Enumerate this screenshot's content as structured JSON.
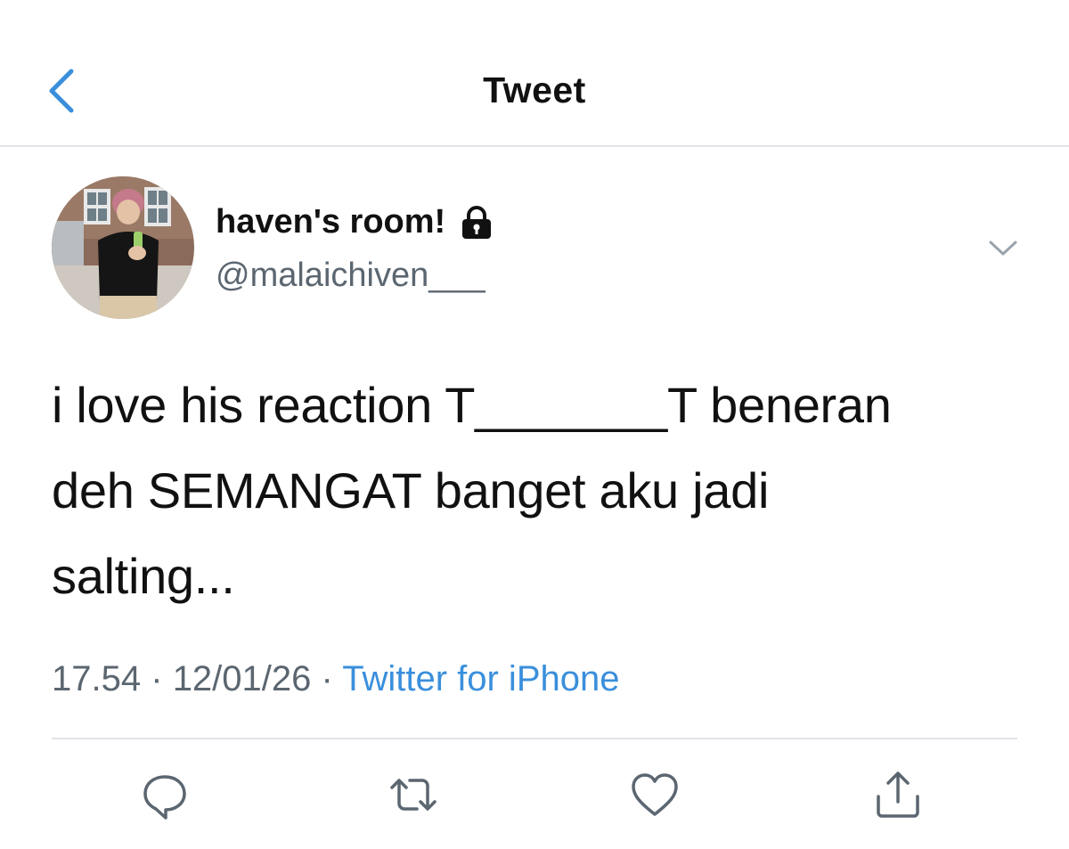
{
  "header": {
    "title": "Tweet",
    "back_icon": "chevron-left-icon",
    "accent_color": "#3a8fdc"
  },
  "author": {
    "display_name": "haven's room!",
    "handle": "@malaichiven___",
    "protected_icon": "lock-icon",
    "more_icon": "chevron-down-icon"
  },
  "tweet": {
    "text": "i love his reaction T_______T beneran\ndeh SEMANGAT banget aku jadi\nsalting..."
  },
  "meta": {
    "time": "17.54",
    "separator": "·",
    "date": "12/01/26",
    "source": "Twitter for iPhone",
    "source_color": "#3a8fdc"
  },
  "actions": [
    "reply-icon",
    "retweet-icon",
    "like-icon",
    "share-icon"
  ]
}
